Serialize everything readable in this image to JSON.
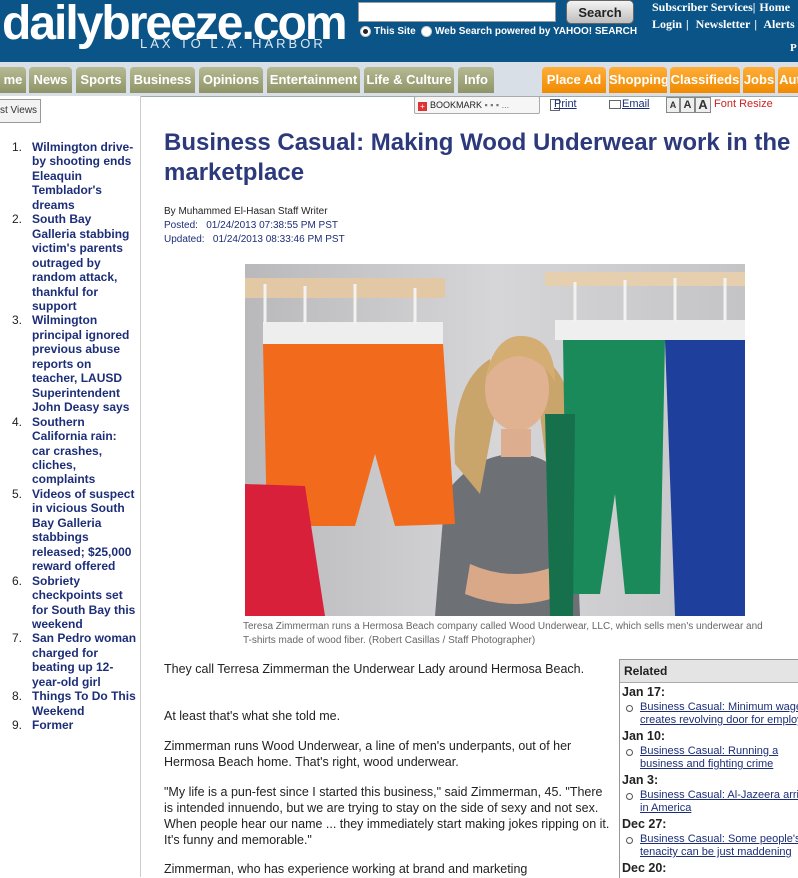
{
  "header": {
    "logo": "dailybreeze.com",
    "tagline": "LAX TO L.A. HARBOR",
    "search": {
      "placeholder": "",
      "button_label": "Search"
    },
    "radio_this_site": "This Site",
    "radio_web": "Web Search powered by YAHOO! SEARCH",
    "account": {
      "subscriber": "Subscriber Services|",
      "home": "Home",
      "login": "Login",
      "newsletter": "Newsletter",
      "alerts": "Alerts",
      "sep": "|",
      "p": "P"
    }
  },
  "nav": {
    "tabs": [
      "me",
      "News",
      "Sports",
      "Business",
      "Opinions",
      "Entertainment",
      "Life & Culture",
      "Info"
    ],
    "right_tabs": [
      "Place Ad",
      "Shopping",
      "Classifieds",
      "Jobs",
      "Aut"
    ]
  },
  "sidebar": {
    "tab_label": "st Views",
    "items": [
      {
        "num": "1.",
        "text": "Wilmington drive-by shooting ends Eleaquin Temblador's dreams"
      },
      {
        "num": "2.",
        "text": "South Bay Galleria stabbing victim's parents outraged by random attack, thankful for support"
      },
      {
        "num": "3.",
        "text": "Wilmington principal ignored previous abuse reports on teacher, LAUSD Superintendent John Deasy says"
      },
      {
        "num": "4.",
        "text": "Southern California rain: car crashes, cliches, complaints"
      },
      {
        "num": "5.",
        "text": "Videos of suspect in vicious South Bay Galleria stabbings released; $25,000 reward offered"
      },
      {
        "num": "6.",
        "text": "Sobriety checkpoints set for South Bay this weekend"
      },
      {
        "num": "7.",
        "text": "San Pedro woman charged for beating up 12-year-old girl"
      },
      {
        "num": "8.",
        "text": "Things To Do This Weekend"
      },
      {
        "num": "9.",
        "text": "Former"
      }
    ]
  },
  "tools": {
    "bookmark": "BOOKMARK",
    "print": "Print",
    "email": "Email",
    "font_a1": "A",
    "font_a2": "A",
    "font_a3": "A",
    "font_resize": "Font Resize"
  },
  "article": {
    "headline": "Business Casual: Making Wood Underwear work in the marketplace",
    "byline": "By Muhammed El-Hasan Staff Writer",
    "posted": "Posted:   01/24/2013 07:38:55 PM PST",
    "updated": "Updated:   01/24/2013 08:33:46 PM PST",
    "caption": "Teresa Zimmerman runs a Hermosa Beach company called Wood Underwear, LLC, which sells men's underwear and T-shirts made of wood fiber. (Robert Casillas / Staff Photographer)",
    "paragraphs": [
      "They call Terresa Zimmerman the Underwear Lady around Hermosa Beach.",
      "At least that's what she told me.",
      "Zimmerman runs Wood Underwear, a line of men's underpants, out of her Hermosa Beach home. That's right, wood underwear.",
      "\"My life is a pun-fest since I started this business,\" said Zimmerman, 45. \"There is intended innuendo, but we are trying to stay on the side of sexy and not sex. When people hear our name ... they immediately start making jokes ripping on it. It's funny and memorable.\"",
      "Zimmerman, who has experience working at brand and marketing"
    ]
  },
  "related": {
    "title": "Related",
    "groups": [
      {
        "date": "Jan 17:",
        "lines": [
          "Business Casual: Minimum wage",
          "creates revolving door for employ"
        ]
      },
      {
        "date": "Jan 10:",
        "lines": [
          "Business Casual: Running a",
          "business and fighting crime"
        ]
      },
      {
        "date": "Jan 3:",
        "lines": [
          "Business Casual: Al-Jazeera arri",
          "in America"
        ]
      },
      {
        "date": "Dec 27:",
        "lines": [
          "Business Casual: Some people's",
          "tenacity can be just maddening"
        ]
      },
      {
        "date": "Dec 20:",
        "lines": []
      }
    ]
  },
  "colors": {
    "header_bg": "#0a5488",
    "nav_olive": "#a5a97f",
    "nav_orange": "#f59a14",
    "headline": "#2c3a7c",
    "link": "#1d2e78"
  }
}
